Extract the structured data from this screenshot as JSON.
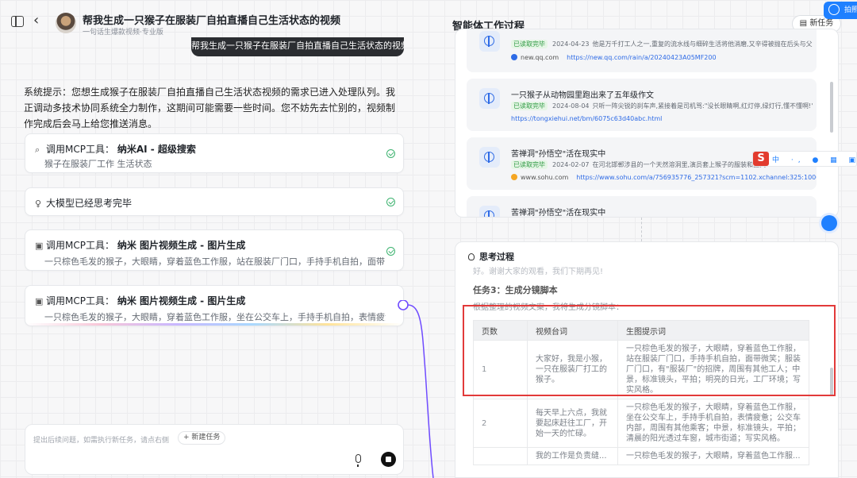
{
  "header": {
    "title": "帮我生成一只猴子在服装厂自拍直播自己生活状态的视频",
    "subtitle": "一句话生爆款视频·专业版"
  },
  "chat": {
    "user_message": "帮我生成一只猴子在服装厂自拍直播自己生活状态的视频",
    "system_message": "系统提示：您想生成猴子在服装厂自拍直播自己生活状态视频的需求已进入处理队列。我正调动多技术协同系统全力制作，这期间可能需要一些时间。您不妨先去忙别的，视频制作完成后会马上给您推送消息。",
    "tools": [
      {
        "prefix": "调用MCP工具：",
        "name": "纳米AI - 超级搜索",
        "desc": "猴子在服装厂工作 生活状态",
        "done": true
      },
      {
        "prefix": "",
        "name": "大模型已经思考完毕",
        "desc": "",
        "done": true
      },
      {
        "prefix": "调用MCP工具：",
        "name": "纳米 图片视频生成 - 图片生成",
        "desc": "一只棕色毛发的猴子，大眼睛，穿着蓝色工作服，站在服装厂门口，手持手机自拍，面带...",
        "done": true
      },
      {
        "prefix": "调用MCP工具：",
        "name": "纳米 图片视频生成 - 图片生成",
        "desc": "一只棕色毛发的猴子，大眼睛，穿着蓝色工作服，坐在公交车上，手持手机自拍，表情疲惫...",
        "done": false
      }
    ]
  },
  "input": {
    "placeholder": "提出后续问题，如需执行新任务，请点右侧",
    "new_task_label": "+ 新建任务"
  },
  "workspace": {
    "title": "智能体工作过程",
    "new_task_label": "新任务",
    "share_label": "拍照"
  },
  "search_results": [
    {
      "title": "",
      "badge": "已读取完毕",
      "date": "2024-04-23",
      "snippet": "他是万千打工人之一,重复的流水线与细碎生活将他消磨,又辛得被抛在后头与父...",
      "site": "new.qq.com",
      "url": "https://new.qq.com/rain/a/20240423A05MF200"
    },
    {
      "title": "一只猴子从动物园里跑出来了五年级作文",
      "badge": "已读取完毕",
      "date": "2024-08-04",
      "snippet": "只听一阵尖锐的刹车声,紧接着是司机骂:\"没长眼睛啊,红灯停,绿灯行,懂不懂啊!\"...",
      "site": "",
      "url": "https://tongxiehui.net/bm/6075c63d40abc.html"
    },
    {
      "title": "苦禅洞\"孙悟空\"活在现实中",
      "badge": "已读取完毕",
      "date": "2024-02-07",
      "snippet": "在河北邯郸涉县的一个天然溶洞里,演员套上猴子的服装和面具...",
      "site": "www.sohu.com",
      "url": "https://www.sohu.com/a/756935776_257321?scm=1102.xchannel:325:100002.0.6.0"
    },
    {
      "title": "苦禅洞\"孙悟空\"活在现实中",
      "badge": "",
      "date": "",
      "snippet": "",
      "site": "",
      "url": ""
    }
  ],
  "ime": {
    "logo": "S",
    "items": "中 ·, ● ▦ ▣ ▾ ◉"
  },
  "thinking": {
    "title": "思考过程",
    "faded_line": "好。谢谢大家的观看，我们下期再见!",
    "task_heading": "任务3：生成分镜脚本",
    "task_sub": "根据整理的视频文案，我将生成分镜脚本：",
    "table": {
      "headers": [
        "页数",
        "视频台词",
        "生图提示词"
      ],
      "rows": [
        [
          "1",
          "大家好，我是小猴，一只在服装厂打工的猴子。",
          "一只棕色毛发的猴子，大眼睛，穿着蓝色工作服，站在服装厂门口，手持手机自拍，面带微笑；服装厂门口，有\"服装厂\"的招牌，周围有其他工人；中景，标准镜头，平拍；明亮的日光，工厂环境；写实风格。"
        ],
        [
          "2",
          "每天早上六点，我就要起床赶往工厂，开始一天的忙碌。",
          "一只棕色毛发的猴子，大眼睛，穿着蓝色工作服，坐在公交车上，手持手机自拍，表情疲惫；公交车内部，周围有其他乘客；中景，标准镜头，平拍；清晨的阳光透过车窗，城市街道；写实风格。"
        ],
        [
          "",
          "我的工作是负责缝...",
          "一只棕色毛发的猴子，大眼睛，穿着蓝色工作服..."
        ]
      ]
    }
  },
  "colors": {
    "accent": "#1f80ff",
    "success": "#3eb370",
    "highlight": "#e23a3a",
    "bubble": "#2b2d31"
  }
}
